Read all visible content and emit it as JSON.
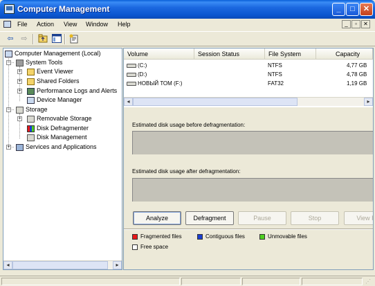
{
  "window": {
    "title": "Computer Management",
    "controls": {
      "minimize": "_",
      "maximize": "□",
      "close": "✕"
    }
  },
  "menu": {
    "items": [
      "File",
      "Action",
      "View",
      "Window",
      "Help"
    ],
    "mdi_controls": [
      "_",
      "▫",
      "✕"
    ]
  },
  "toolbar": {
    "icons": [
      "back-arrow-icon",
      "forward-arrow-icon",
      "folder-up-icon",
      "show-hide-tree-icon",
      "properties-icon"
    ]
  },
  "tree": {
    "root": "Computer Management (Local)",
    "system_tools": "System Tools",
    "event_viewer": "Event Viewer",
    "shared_folders": "Shared Folders",
    "perf_logs": "Performance Logs and Alerts",
    "device_manager": "Device Manager",
    "storage": "Storage",
    "removable_storage": "Removable Storage",
    "disk_defragmenter": "Disk Defragmenter",
    "disk_management": "Disk Management",
    "services": "Services and Applications"
  },
  "volumes": {
    "columns": [
      "Volume",
      "Session Status",
      "File System",
      "Capacity"
    ],
    "rows": [
      {
        "volume": "(C:)",
        "status": "",
        "fs": "NTFS",
        "capacity": "4,77 GB"
      },
      {
        "volume": "(D:)",
        "status": "",
        "fs": "NTFS",
        "capacity": "4,78 GB"
      },
      {
        "volume": "НОВЫЙ ТОМ (F:)",
        "status": "",
        "fs": "FAT32",
        "capacity": "1,19 GB"
      }
    ]
  },
  "defrag": {
    "before_label": "Estimated disk usage before defragmentation:",
    "after_label": "Estimated disk usage after defragmentation:",
    "buttons": {
      "analyze": "Analyze",
      "defragment": "Defragment",
      "pause": "Pause",
      "stop": "Stop",
      "view_report": "View Re"
    },
    "legend": {
      "fragmented": "Fragmented files",
      "contiguous": "Contiguous files",
      "unmovable": "Unmovable files",
      "free": "Free space"
    },
    "colors": {
      "fragmented": "#e81818",
      "contiguous": "#1a3fd0",
      "unmovable": "#50d020",
      "free": "#ffffff"
    }
  }
}
